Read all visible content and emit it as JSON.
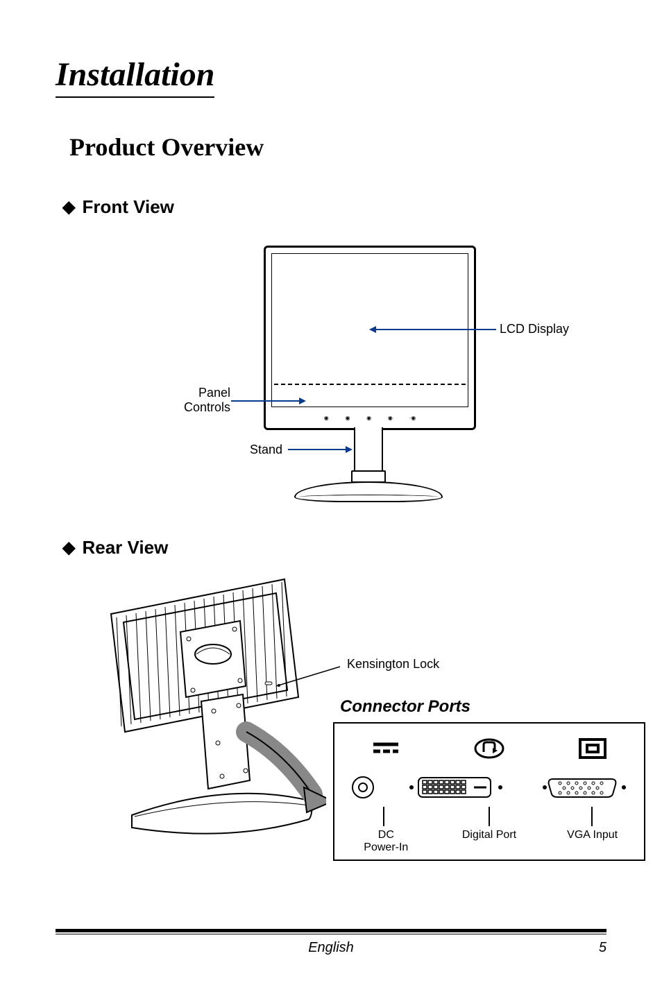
{
  "title": "Installation",
  "subtitle": "Product Overview",
  "sections": {
    "front": {
      "heading": "Front View",
      "labels": {
        "lcd_display": "LCD Display",
        "panel_controls": "Panel\nControls",
        "stand": "Stand"
      }
    },
    "rear": {
      "heading": "Rear  View",
      "labels": {
        "kensington": "Kensington Lock"
      },
      "connector_title": "Connector Ports",
      "ports": {
        "dc": "DC\nPower-In",
        "digital": "Digital Port",
        "vga": "VGA Input"
      }
    }
  },
  "footer": {
    "language": "English",
    "page_number": "5"
  }
}
